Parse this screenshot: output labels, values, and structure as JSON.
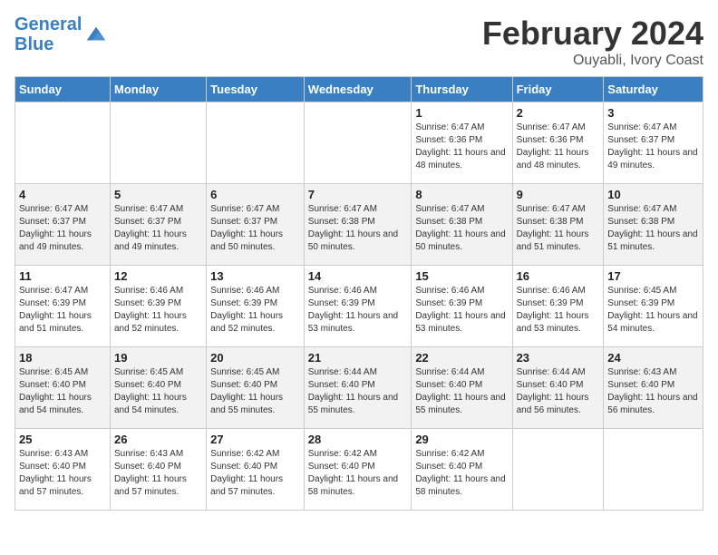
{
  "logo": {
    "text_general": "General",
    "text_blue": "Blue"
  },
  "header": {
    "title": "February 2024",
    "subtitle": "Ouyabli, Ivory Coast"
  },
  "weekdays": [
    "Sunday",
    "Monday",
    "Tuesday",
    "Wednesday",
    "Thursday",
    "Friday",
    "Saturday"
  ],
  "weeks": [
    [
      {
        "day": "",
        "empty": true
      },
      {
        "day": "",
        "empty": true
      },
      {
        "day": "",
        "empty": true
      },
      {
        "day": "",
        "empty": true
      },
      {
        "day": "1",
        "sunrise": "6:47 AM",
        "sunset": "6:36 PM",
        "daylight": "11 hours and 48 minutes."
      },
      {
        "day": "2",
        "sunrise": "6:47 AM",
        "sunset": "6:36 PM",
        "daylight": "11 hours and 48 minutes."
      },
      {
        "day": "3",
        "sunrise": "6:47 AM",
        "sunset": "6:37 PM",
        "daylight": "11 hours and 49 minutes."
      }
    ],
    [
      {
        "day": "4",
        "sunrise": "6:47 AM",
        "sunset": "6:37 PM",
        "daylight": "11 hours and 49 minutes."
      },
      {
        "day": "5",
        "sunrise": "6:47 AM",
        "sunset": "6:37 PM",
        "daylight": "11 hours and 49 minutes."
      },
      {
        "day": "6",
        "sunrise": "6:47 AM",
        "sunset": "6:37 PM",
        "daylight": "11 hours and 50 minutes."
      },
      {
        "day": "7",
        "sunrise": "6:47 AM",
        "sunset": "6:38 PM",
        "daylight": "11 hours and 50 minutes."
      },
      {
        "day": "8",
        "sunrise": "6:47 AM",
        "sunset": "6:38 PM",
        "daylight": "11 hours and 50 minutes."
      },
      {
        "day": "9",
        "sunrise": "6:47 AM",
        "sunset": "6:38 PM",
        "daylight": "11 hours and 51 minutes."
      },
      {
        "day": "10",
        "sunrise": "6:47 AM",
        "sunset": "6:38 PM",
        "daylight": "11 hours and 51 minutes."
      }
    ],
    [
      {
        "day": "11",
        "sunrise": "6:47 AM",
        "sunset": "6:39 PM",
        "daylight": "11 hours and 51 minutes."
      },
      {
        "day": "12",
        "sunrise": "6:46 AM",
        "sunset": "6:39 PM",
        "daylight": "11 hours and 52 minutes."
      },
      {
        "day": "13",
        "sunrise": "6:46 AM",
        "sunset": "6:39 PM",
        "daylight": "11 hours and 52 minutes."
      },
      {
        "day": "14",
        "sunrise": "6:46 AM",
        "sunset": "6:39 PM",
        "daylight": "11 hours and 53 minutes."
      },
      {
        "day": "15",
        "sunrise": "6:46 AM",
        "sunset": "6:39 PM",
        "daylight": "11 hours and 53 minutes."
      },
      {
        "day": "16",
        "sunrise": "6:46 AM",
        "sunset": "6:39 PM",
        "daylight": "11 hours and 53 minutes."
      },
      {
        "day": "17",
        "sunrise": "6:45 AM",
        "sunset": "6:39 PM",
        "daylight": "11 hours and 54 minutes."
      }
    ],
    [
      {
        "day": "18",
        "sunrise": "6:45 AM",
        "sunset": "6:40 PM",
        "daylight": "11 hours and 54 minutes."
      },
      {
        "day": "19",
        "sunrise": "6:45 AM",
        "sunset": "6:40 PM",
        "daylight": "11 hours and 54 minutes."
      },
      {
        "day": "20",
        "sunrise": "6:45 AM",
        "sunset": "6:40 PM",
        "daylight": "11 hours and 55 minutes."
      },
      {
        "day": "21",
        "sunrise": "6:44 AM",
        "sunset": "6:40 PM",
        "daylight": "11 hours and 55 minutes."
      },
      {
        "day": "22",
        "sunrise": "6:44 AM",
        "sunset": "6:40 PM",
        "daylight": "11 hours and 55 minutes."
      },
      {
        "day": "23",
        "sunrise": "6:44 AM",
        "sunset": "6:40 PM",
        "daylight": "11 hours and 56 minutes."
      },
      {
        "day": "24",
        "sunrise": "6:43 AM",
        "sunset": "6:40 PM",
        "daylight": "11 hours and 56 minutes."
      }
    ],
    [
      {
        "day": "25",
        "sunrise": "6:43 AM",
        "sunset": "6:40 PM",
        "daylight": "11 hours and 57 minutes."
      },
      {
        "day": "26",
        "sunrise": "6:43 AM",
        "sunset": "6:40 PM",
        "daylight": "11 hours and 57 minutes."
      },
      {
        "day": "27",
        "sunrise": "6:42 AM",
        "sunset": "6:40 PM",
        "daylight": "11 hours and 57 minutes."
      },
      {
        "day": "28",
        "sunrise": "6:42 AM",
        "sunset": "6:40 PM",
        "daylight": "11 hours and 58 minutes."
      },
      {
        "day": "29",
        "sunrise": "6:42 AM",
        "sunset": "6:40 PM",
        "daylight": "11 hours and 58 minutes."
      },
      {
        "day": "",
        "empty": true
      },
      {
        "day": "",
        "empty": true
      }
    ]
  ]
}
